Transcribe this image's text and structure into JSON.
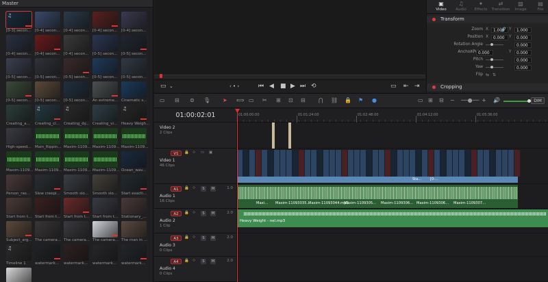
{
  "media_pool": {
    "title": "Master",
    "clips": [
      {
        "label": "[0-3] secon...",
        "kind": "video",
        "bg": "#1a2a3a",
        "note": "♫",
        "sel": true
      },
      {
        "label": "[0-4] secon...",
        "kind": "video",
        "bg": "#3a4a6a"
      },
      {
        "label": "[0-4] secon...",
        "kind": "video",
        "bg": "#2a3a4a"
      },
      {
        "label": "[0-4] secon...",
        "kind": "video",
        "bg": "#5a2020"
      },
      {
        "label": "[0-4] secon...",
        "kind": "video",
        "bg": "#3a3a50"
      },
      {
        "label": "[0-4] secon...",
        "kind": "video",
        "bg": "#2a3040"
      },
      {
        "label": "[0-4] secon...",
        "kind": "video",
        "bg": "#6a1a1a"
      },
      {
        "label": "[0-4] secon...",
        "kind": "video",
        "bg": "#3a3a3a"
      },
      {
        "label": "[0-5] secon...",
        "kind": "video",
        "bg": "#2a3550"
      },
      {
        "label": "[0-5] secon...",
        "kind": "video",
        "bg": "#202630"
      },
      {
        "label": "[0-5] secon...",
        "kind": "video",
        "bg": "#3a4050"
      },
      {
        "label": "[0-5] secon...",
        "kind": "video",
        "bg": "#30323a"
      },
      {
        "label": "[0-5] secon...",
        "kind": "video",
        "bg": "#3a2a2a"
      },
      {
        "label": "[0-5] secon...",
        "kind": "video",
        "bg": "#1e3a5a"
      },
      {
        "label": "[0-5] secon...",
        "kind": "video",
        "bg": "#303a44"
      },
      {
        "label": "[0-5] secon...",
        "kind": "video",
        "bg": "#3a4a3a"
      },
      {
        "label": "[0-5] secon...",
        "kind": "video",
        "bg": "#5a4a3a"
      },
      {
        "label": "[0-5] secon...",
        "kind": "video",
        "bg": "#203040"
      },
      {
        "label": "An extreme...",
        "kind": "video",
        "bg": "#4a5050"
      },
      {
        "label": "Cinematic s...",
        "kind": "video",
        "bg": "#1a3a5a"
      },
      {
        "label": "Creating_a...",
        "kind": "video",
        "bg": "#2a3e3a"
      },
      {
        "label": "Creating_cl...",
        "kind": "video",
        "bg": "#253a40",
        "note": "♫"
      },
      {
        "label": "Creating_dy...",
        "kind": "video",
        "bg": "#2a2a2a",
        "note": "♫"
      },
      {
        "label": "Creating_vi...",
        "kind": "video",
        "bg": "#2e3e44"
      },
      {
        "label": "Heavy Weigh...",
        "kind": "video",
        "bg": "#262626",
        "note": "♫"
      },
      {
        "label": "High-speed...",
        "kind": "video",
        "bg": "#3a3a44"
      },
      {
        "label": "Main_Rippin...",
        "kind": "audio"
      },
      {
        "label": "Maxim-1109...",
        "kind": "audio"
      },
      {
        "label": "Maxim-1109...",
        "kind": "audio"
      },
      {
        "label": "Maxim-1109...",
        "kind": "audio"
      },
      {
        "label": "Maxim-1109...",
        "kind": "audio"
      },
      {
        "label": "Maxim-1109...",
        "kind": "audio"
      },
      {
        "label": "Maxim-1109...",
        "kind": "audio"
      },
      {
        "label": "Maxim-1109...",
        "kind": "audio"
      },
      {
        "label": "Ocean_wav...",
        "kind": "video",
        "bg": "#1a2a40"
      },
      {
        "label": "Person_ras...",
        "kind": "video",
        "bg": "#4a3a3a"
      },
      {
        "label": "Slow creepi...",
        "kind": "video",
        "bg": "#2a2e34"
      },
      {
        "label": "Smooth slo...",
        "kind": "video",
        "bg": "#3a3e44"
      },
      {
        "label": "Smooth slo...",
        "kind": "video",
        "bg": "#44403a"
      },
      {
        "label": "Start exacti...",
        "kind": "video",
        "bg": "#222a30"
      },
      {
        "label": "Start from t...",
        "kind": "video",
        "bg": "#4a3a36"
      },
      {
        "label": "Start from t...",
        "kind": "video",
        "bg": "#3a2020"
      },
      {
        "label": "Start from t...",
        "kind": "video",
        "bg": "#6a2a2a"
      },
      {
        "label": "Start from t...",
        "kind": "video",
        "bg": "#3a3a44"
      },
      {
        "label": "Stationary_...",
        "kind": "video",
        "bg": "#4a3a3a"
      },
      {
        "label": "Subject_arg...",
        "kind": "video",
        "bg": "#5a4a3a"
      },
      {
        "label": "The camera...",
        "kind": "video",
        "bg": "#3a3636"
      },
      {
        "label": "The camera...",
        "kind": "video",
        "bg": "#3a3a40"
      },
      {
        "label": "The camera...",
        "kind": "video",
        "bg": "#d0d4da"
      },
      {
        "label": "The man in ...",
        "kind": "video",
        "bg": "#5a4a40"
      },
      {
        "label": "Timeline 1",
        "kind": "video",
        "bg": "#2a2a2a",
        "note": "♫"
      },
      {
        "label": "watermark...",
        "kind": "video",
        "bg": "#202226"
      },
      {
        "label": "watermark...",
        "kind": "video",
        "bg": "#2e2020"
      },
      {
        "label": "watermark...",
        "kind": "video",
        "bg": "#26262a"
      },
      {
        "label": "watermark...",
        "kind": "video",
        "bg": "#22262a"
      },
      {
        "label": "Wireframe_...",
        "kind": "video",
        "bg": "#d8d8d8"
      }
    ]
  },
  "viewer": {
    "stop_icon": "■",
    "prev_icon": "⏮",
    "back_icon": "◀",
    "play_icon": "▶",
    "next_icon": "⏭",
    "loop_icon": "⟲",
    "nav_dots": "‹ • ›",
    "view_icon": "▭",
    "chev": "⌄",
    "skip_in": "⇤",
    "skip_out": "⇥"
  },
  "inspector": {
    "tabs": [
      {
        "icon": "▣",
        "label": "Video",
        "active": true
      },
      {
        "icon": "♫",
        "label": "Audio"
      },
      {
        "icon": "✦",
        "label": "Effects"
      },
      {
        "icon": "⇄",
        "label": "Transition"
      },
      {
        "icon": "▨",
        "label": "Image"
      },
      {
        "icon": "▤",
        "label": "File"
      }
    ],
    "transform_title": "Transform",
    "cropping_title": "Cropping",
    "zoom": {
      "label": "Zoom",
      "x": "1.000",
      "y": "1.000"
    },
    "position": {
      "label": "Position",
      "x": "0.000",
      "y": "0.000"
    },
    "rotation": {
      "label": "Rotation Angle",
      "value": "0.000"
    },
    "anchor": {
      "label": "Anchor Point",
      "x": "0.000",
      "y": "0.000"
    },
    "pitch": {
      "label": "Pitch",
      "value": "0.000"
    },
    "yaw": {
      "label": "Yaw",
      "value": "0.000"
    },
    "flip": {
      "label": "Flip"
    },
    "x_lbl": "X",
    "y_lbl": "Y",
    "link_icon": "🔗"
  },
  "toolbar": {
    "dim_label": "DIM",
    "speaker_icon": "🔊"
  },
  "timeline": {
    "timecode": "01:00:02:01",
    "ruler": [
      "01:00:00:00",
      "01:01:24:00",
      "01:02:48:00",
      "01:04:12:00",
      "01:05:36:00"
    ],
    "tracks": {
      "video2": {
        "name": "Video 2",
        "count": "2 Clips"
      },
      "video1": {
        "badge": "V1",
        "name": "Video 1",
        "count": "46 Clips"
      },
      "audio1": {
        "badge": "A1",
        "name": "Audio 1",
        "count": "16 Clips",
        "level": "1.0"
      },
      "audio2": {
        "badge": "A2",
        "name": "Audio 2",
        "count": "1 Clip",
        "level": "2.0"
      },
      "audio3": {
        "badge": "A3",
        "name": "Audio 3",
        "count": "0 Clips",
        "level": "2.0"
      },
      "audio4": {
        "badge": "A4",
        "name": "Audio 4",
        "count": "0 Clips",
        "level": "2.0"
      }
    },
    "s_lbl": "S",
    "m_lbl": "M",
    "lock_icon": "🔒",
    "link_icon": "⟐",
    "v1_labels": [
      "Sta...",
      "[0-..."
    ],
    "a1_labels": [
      "Maxi...",
      "Maxim-11093035...",
      "Maxim-11093044.mp3",
      "Maxim-1109305...",
      "Maxim-1109306...",
      "Maxim-1109306...",
      "Maxim-1109307..."
    ],
    "a2_label": "Heavy Weight - nel.mp3"
  }
}
